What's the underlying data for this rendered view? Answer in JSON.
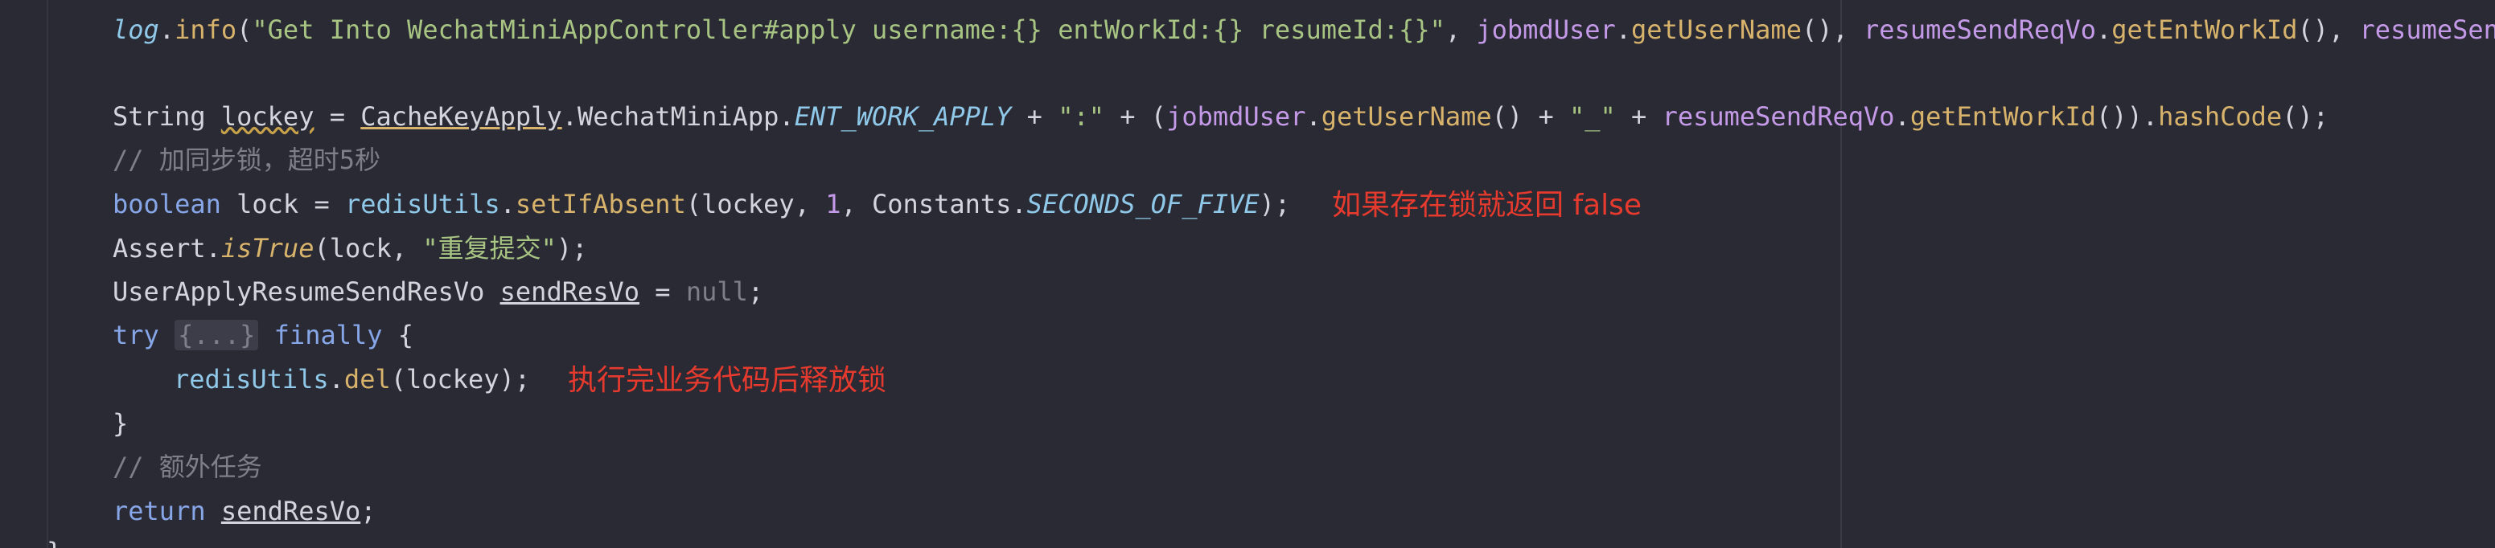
{
  "lines": {
    "l1": {
      "obj": "log",
      "dot1": ".",
      "method": "info",
      "open": "(",
      "str": "\"Get Into WechatMiniAppController#apply username:{} entWorkId:{} resumeId:{}\"",
      "comma1": ", ",
      "user": "jobmdUser",
      "dot2": ".",
      "getName": "getUserName",
      "paren1": "(), ",
      "vo": "resumeSendReqVo",
      "dot3": ".",
      "getEnt": "getEntWorkId",
      "paren2": "(), ",
      "vo2": "resumeSend"
    },
    "l2": {
      "type": "String ",
      "var": "lockey",
      "eq": " = ",
      "cls": "CacheKeyApply",
      "mid": ".WechatMiniApp.",
      "const": "ENT_WORK_APPLY",
      "plus1": " + ",
      "colon": "\":\"",
      "plus2": " + (",
      "user": "jobmdUser",
      "dot1": ".",
      "getName": "getUserName",
      "plus3": "() + ",
      "under": "\"_\"",
      "plus4": " + ",
      "vo": "resumeSendReqVo",
      "dot2": ".",
      "getEnt": "getEntWorkId",
      "close": "()).",
      "hash": "hashCode",
      "end": "();"
    },
    "l3": {
      "comment": "// 加同步锁，超时5秒"
    },
    "l4": {
      "kw": "boolean",
      "rest1": " lock = ",
      "obj": "redisUtils",
      "dot": ".",
      "method": "setIfAbsent",
      "args1": "(lockey, ",
      "num": "1",
      "args2": ", Constants.",
      "const": "SECONDS_OF_FIVE",
      "end": ");"
    },
    "l5": {
      "cls": "Assert.",
      "method": "isTrue",
      "args": "(lock, ",
      "str": "\"重复提交\"",
      "end": ");"
    },
    "l6": {
      "type": "UserApplyResumeSendResVo ",
      "var": "sendResVo",
      "eq": " = ",
      "nullkw": "null",
      "end": ";"
    },
    "l7": {
      "try": "try",
      "fold": "{...}",
      "finally": "finally",
      "brace": " {"
    },
    "l8": {
      "obj": "redisUtils",
      "dot": ".",
      "method": "del",
      "args": "(lockey);"
    },
    "l9": {
      "brace": "}"
    },
    "l10": {
      "comment": "// 额外任务"
    },
    "l11": {
      "kw": "return",
      "var": "sendResVo",
      "end": ";"
    },
    "l12": {
      "brace": "}"
    }
  },
  "annotations": {
    "lock_note": "如果存在锁就返回 false",
    "release_note": "执行完业务代码后释放锁"
  },
  "colors": {
    "background": "#292a33",
    "annotation": "#e63a2e"
  }
}
